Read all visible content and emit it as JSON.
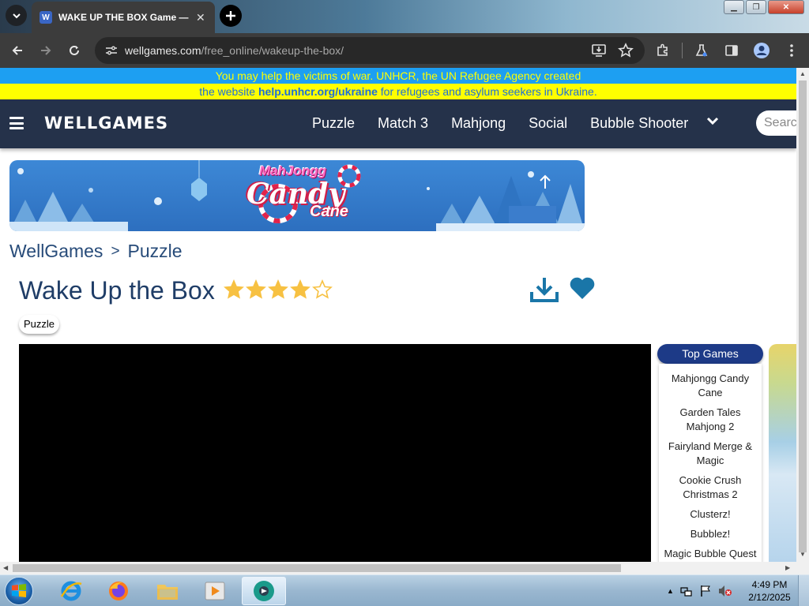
{
  "browser": {
    "tab_title": "WAKE UP THE BOX Game — Free Online",
    "tab_favicon_letter": "W",
    "url_host": "wellgames.com",
    "url_path": "/free_online/wakeup-the-box/"
  },
  "banner": {
    "line1": "You may help the victims of war. UNHCR, the UN Refugee Agency created",
    "line2_prefix": "the website ",
    "line2_link": "help.unhcr.org/ukraine",
    "line2_suffix": " for refugees and asylum seekers in Ukraine."
  },
  "site": {
    "logo": "WELLGAMES",
    "nav": [
      "Puzzle",
      "Match 3",
      "Mahjong",
      "Social",
      "Bubble Shooter"
    ],
    "search_placeholder": "Search"
  },
  "promo": {
    "line1": "MahJongg",
    "line2": "Candy",
    "line3": "Cane"
  },
  "breadcrumb": {
    "home": "WellGames",
    "separator": ">",
    "category": "Puzzle"
  },
  "game": {
    "title": "Wake Up the Box",
    "rating": 4,
    "rating_max": 5,
    "tag": "Puzzle"
  },
  "top_games": {
    "header": "Top Games",
    "items": [
      "Mahjongg Candy Cane",
      "Garden Tales Mahjong 2",
      "Fairyland Merge & Magic",
      "Cookie Crush Christmas 2",
      "Clusterz!",
      "Bubblez!",
      "Magic Bubble Quest"
    ]
  },
  "taskbar": {
    "time": "4:49 PM",
    "date": "2/12/2025"
  },
  "colors": {
    "site_header": "#25324a",
    "banner_blue": "#1d9ff2",
    "banner_yellow": "#ffff00",
    "star": "#f7c142",
    "action_icon": "#1a76a8",
    "top_games_header": "#1d3a87"
  }
}
